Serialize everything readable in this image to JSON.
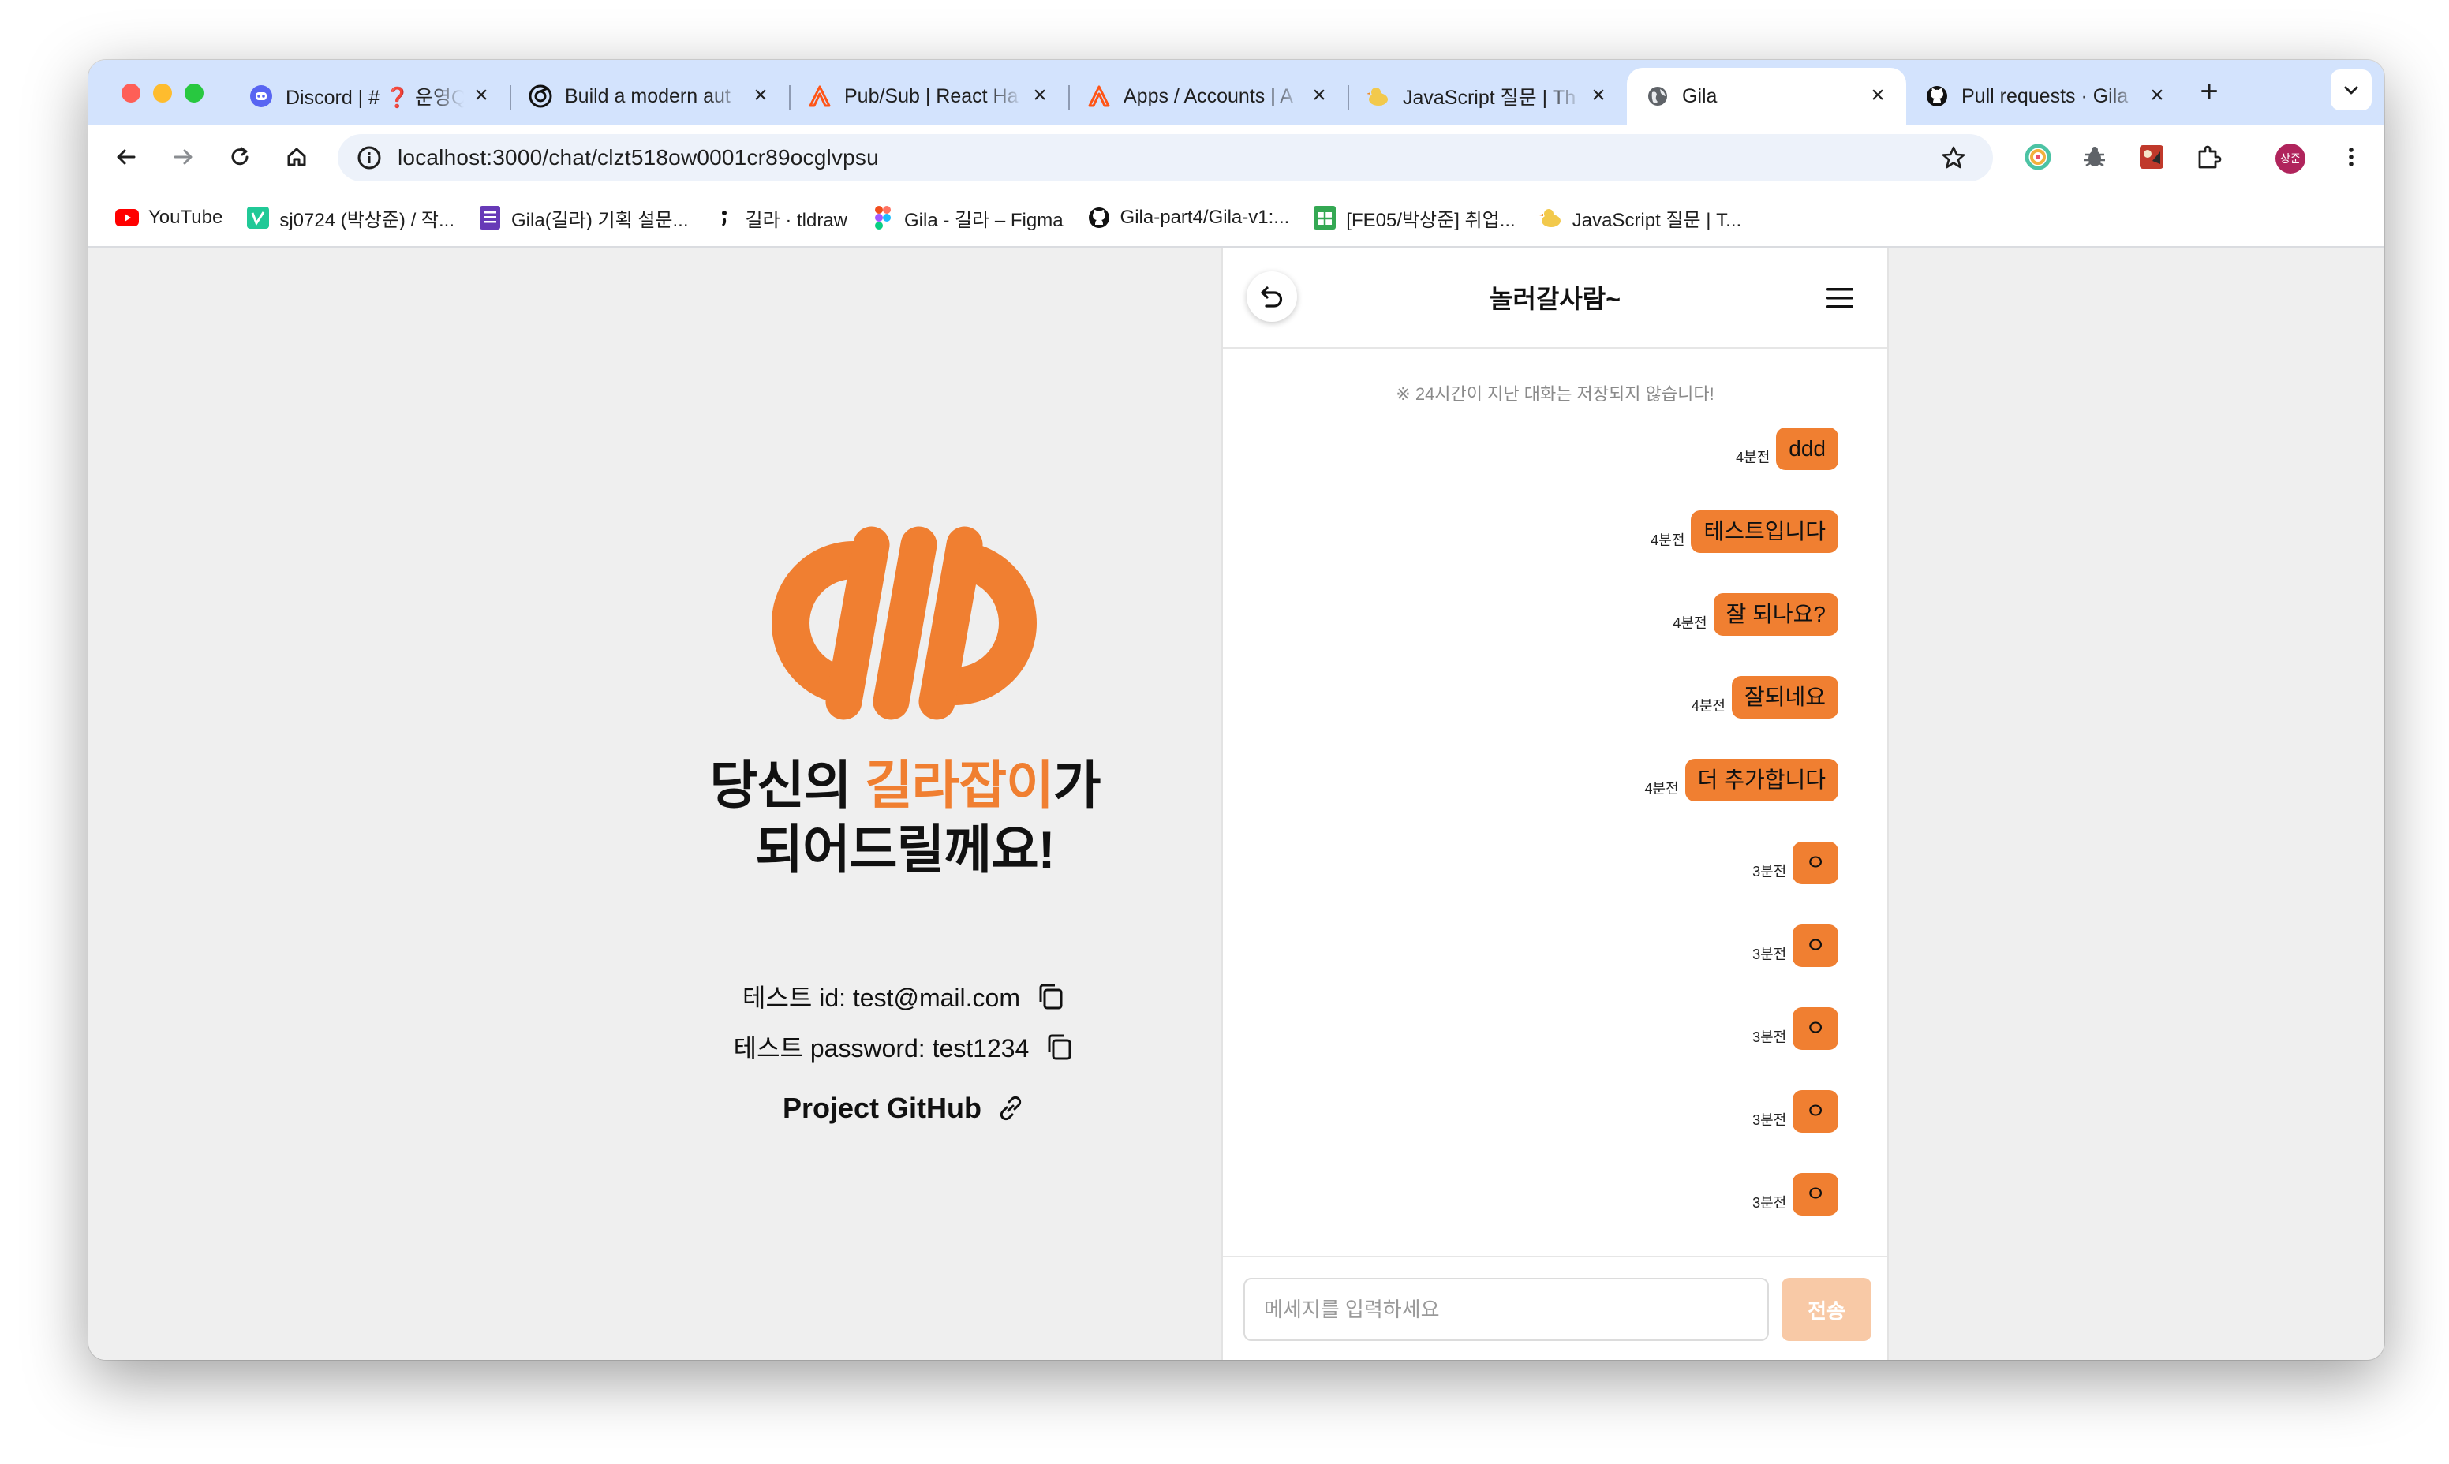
{
  "browser": {
    "tabs": [
      {
        "title": "Discord | # ❓ 운영Q",
        "icon": "discord-icon",
        "color": "#5865f2"
      },
      {
        "title": "Build a modern aut",
        "icon": "auth-icon",
        "color": "#111111"
      },
      {
        "title": "Pub/Sub | React Ha",
        "icon": "ably-icon",
        "color": "#ff5416"
      },
      {
        "title": "Apps / Accounts | A",
        "icon": "ably-icon",
        "color": "#ff5416"
      },
      {
        "title": "JavaScript 질문 | Th",
        "icon": "duck-icon",
        "color": "#f2c94c"
      },
      {
        "title": "Gila",
        "icon": "globe-icon",
        "color": "#444746",
        "active": true
      },
      {
        "title": "Pull requests · Gila",
        "icon": "github-icon",
        "color": "#111111"
      }
    ],
    "new_tab": "+",
    "url": "localhost:3000/chat/clzt518ow0001cr89ocglvpsu",
    "avatar_text": "상준",
    "bookmarks": [
      {
        "label": "YouTube",
        "icon": "youtube-icon"
      },
      {
        "label": "sj0724 (박상준) / 작...",
        "icon": "velog-icon"
      },
      {
        "label": "Gila(길라) 기획 설문...",
        "icon": "form-icon"
      },
      {
        "label": "길라 · tldraw",
        "icon": "tldraw-icon"
      },
      {
        "label": "Gila - 길라 – Figma",
        "icon": "figma-icon"
      },
      {
        "label": "Gila-part4/Gila-v1:...",
        "icon": "github-icon"
      },
      {
        "label": "[FE05/박상준] 취업...",
        "icon": "sheets-icon"
      },
      {
        "label": "JavaScript 질문 | T...",
        "icon": "duck-icon"
      }
    ]
  },
  "landing": {
    "headline_pre": "당신의 ",
    "headline_accent": "길라잡이",
    "headline_post": "가",
    "headline_line2": "되어드릴께요!",
    "test_id": "테스트 id: test@mail.com",
    "test_password": "테스트 password: test1234",
    "github": "Project GitHub",
    "accent_color": "#f07f31"
  },
  "chat": {
    "title": "놀러갈사람~",
    "notice": "※ 24시간이 지난 대화는 저장되지 않습니다!",
    "messages": [
      {
        "time": "4분전",
        "text": "ddd"
      },
      {
        "time": "4분전",
        "text": "테스트입니다"
      },
      {
        "time": "4분전",
        "text": "잘 되나요?"
      },
      {
        "time": "4분전",
        "text": "잘되네요"
      },
      {
        "time": "4분전",
        "text": "더 추가합니다"
      },
      {
        "time": "3분전",
        "text": "ㅇ"
      },
      {
        "time": "3분전",
        "text": "ㅇ"
      },
      {
        "time": "3분전",
        "text": "ㅇ"
      },
      {
        "time": "3분전",
        "text": "ㅇ"
      },
      {
        "time": "3분전",
        "text": "ㅇ"
      }
    ],
    "input_placeholder": "메세지를 입력하세요",
    "send_label": "전송"
  }
}
